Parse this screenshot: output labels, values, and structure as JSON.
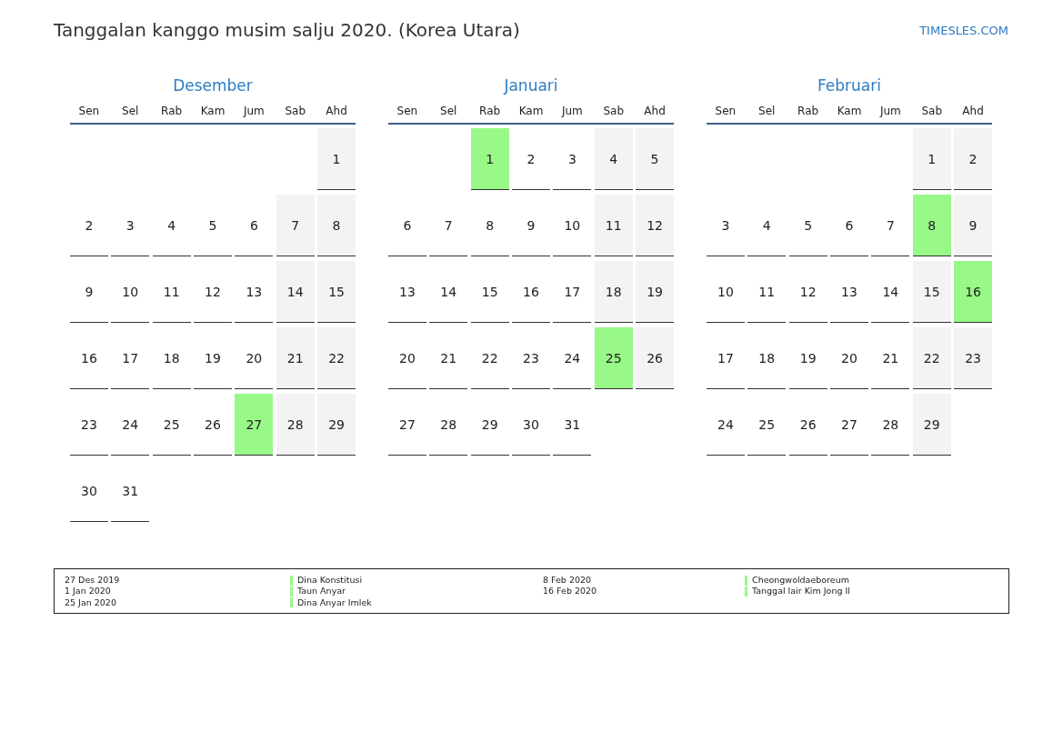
{
  "title": "Tanggalan kanggo musim salju 2020. (Korea Utara)",
  "site": "TIMESLES.COM",
  "months": [
    {
      "name": "Desember",
      "weekdays": [
        "Sen",
        "Sel",
        "Rab",
        "Kam",
        "Jum",
        "Sab",
        "Ahd"
      ],
      "weeks": [
        [
          {
            "kind": "blank"
          },
          {
            "kind": "blank"
          },
          {
            "kind": "blank"
          },
          {
            "kind": "blank"
          },
          {
            "kind": "blank"
          },
          {
            "kind": "blank"
          },
          {
            "kind": "date",
            "day": "1",
            "weekend": true,
            "holiday": false
          }
        ],
        [
          {
            "kind": "date",
            "day": "2",
            "weekend": false,
            "holiday": false
          },
          {
            "kind": "date",
            "day": "3",
            "weekend": false,
            "holiday": false
          },
          {
            "kind": "date",
            "day": "4",
            "weekend": false,
            "holiday": false
          },
          {
            "kind": "date",
            "day": "5",
            "weekend": false,
            "holiday": false
          },
          {
            "kind": "date",
            "day": "6",
            "weekend": false,
            "holiday": false
          },
          {
            "kind": "date",
            "day": "7",
            "weekend": true,
            "holiday": false
          },
          {
            "kind": "date",
            "day": "8",
            "weekend": true,
            "holiday": false
          }
        ],
        [
          {
            "kind": "date",
            "day": "9",
            "weekend": false,
            "holiday": false
          },
          {
            "kind": "date",
            "day": "10",
            "weekend": false,
            "holiday": false
          },
          {
            "kind": "date",
            "day": "11",
            "weekend": false,
            "holiday": false
          },
          {
            "kind": "date",
            "day": "12",
            "weekend": false,
            "holiday": false
          },
          {
            "kind": "date",
            "day": "13",
            "weekend": false,
            "holiday": false
          },
          {
            "kind": "date",
            "day": "14",
            "weekend": true,
            "holiday": false
          },
          {
            "kind": "date",
            "day": "15",
            "weekend": true,
            "holiday": false
          }
        ],
        [
          {
            "kind": "date",
            "day": "16",
            "weekend": false,
            "holiday": false
          },
          {
            "kind": "date",
            "day": "17",
            "weekend": false,
            "holiday": false
          },
          {
            "kind": "date",
            "day": "18",
            "weekend": false,
            "holiday": false
          },
          {
            "kind": "date",
            "day": "19",
            "weekend": false,
            "holiday": false
          },
          {
            "kind": "date",
            "day": "20",
            "weekend": false,
            "holiday": false
          },
          {
            "kind": "date",
            "day": "21",
            "weekend": true,
            "holiday": false
          },
          {
            "kind": "date",
            "day": "22",
            "weekend": true,
            "holiday": false
          }
        ],
        [
          {
            "kind": "date",
            "day": "23",
            "weekend": false,
            "holiday": false
          },
          {
            "kind": "date",
            "day": "24",
            "weekend": false,
            "holiday": false
          },
          {
            "kind": "date",
            "day": "25",
            "weekend": false,
            "holiday": false
          },
          {
            "kind": "date",
            "day": "26",
            "weekend": false,
            "holiday": false
          },
          {
            "kind": "date",
            "day": "27",
            "weekend": false,
            "holiday": true
          },
          {
            "kind": "date",
            "day": "28",
            "weekend": true,
            "holiday": false
          },
          {
            "kind": "date",
            "day": "29",
            "weekend": true,
            "holiday": false
          }
        ],
        [
          {
            "kind": "date",
            "day": "30",
            "weekend": false,
            "holiday": false
          },
          {
            "kind": "date",
            "day": "31",
            "weekend": false,
            "holiday": false
          }
        ]
      ]
    },
    {
      "name": "Januari",
      "weekdays": [
        "Sen",
        "Sel",
        "Rab",
        "Kam",
        "Jum",
        "Sab",
        "Ahd"
      ],
      "weeks": [
        [
          {
            "kind": "blank"
          },
          {
            "kind": "blank"
          },
          {
            "kind": "date",
            "day": "1",
            "weekend": false,
            "holiday": true
          },
          {
            "kind": "date",
            "day": "2",
            "weekend": false,
            "holiday": false
          },
          {
            "kind": "date",
            "day": "3",
            "weekend": false,
            "holiday": false
          },
          {
            "kind": "date",
            "day": "4",
            "weekend": true,
            "holiday": false
          },
          {
            "kind": "date",
            "day": "5",
            "weekend": true,
            "holiday": false
          }
        ],
        [
          {
            "kind": "date",
            "day": "6",
            "weekend": false,
            "holiday": false
          },
          {
            "kind": "date",
            "day": "7",
            "weekend": false,
            "holiday": false
          },
          {
            "kind": "date",
            "day": "8",
            "weekend": false,
            "holiday": false
          },
          {
            "kind": "date",
            "day": "9",
            "weekend": false,
            "holiday": false
          },
          {
            "kind": "date",
            "day": "10",
            "weekend": false,
            "holiday": false
          },
          {
            "kind": "date",
            "day": "11",
            "weekend": true,
            "holiday": false
          },
          {
            "kind": "date",
            "day": "12",
            "weekend": true,
            "holiday": false
          }
        ],
        [
          {
            "kind": "date",
            "day": "13",
            "weekend": false,
            "holiday": false
          },
          {
            "kind": "date",
            "day": "14",
            "weekend": false,
            "holiday": false
          },
          {
            "kind": "date",
            "day": "15",
            "weekend": false,
            "holiday": false
          },
          {
            "kind": "date",
            "day": "16",
            "weekend": false,
            "holiday": false
          },
          {
            "kind": "date",
            "day": "17",
            "weekend": false,
            "holiday": false
          },
          {
            "kind": "date",
            "day": "18",
            "weekend": true,
            "holiday": false
          },
          {
            "kind": "date",
            "day": "19",
            "weekend": true,
            "holiday": false
          }
        ],
        [
          {
            "kind": "date",
            "day": "20",
            "weekend": false,
            "holiday": false
          },
          {
            "kind": "date",
            "day": "21",
            "weekend": false,
            "holiday": false
          },
          {
            "kind": "date",
            "day": "22",
            "weekend": false,
            "holiday": false
          },
          {
            "kind": "date",
            "day": "23",
            "weekend": false,
            "holiday": false
          },
          {
            "kind": "date",
            "day": "24",
            "weekend": false,
            "holiday": false
          },
          {
            "kind": "date",
            "day": "25",
            "weekend": true,
            "holiday": true
          },
          {
            "kind": "date",
            "day": "26",
            "weekend": true,
            "holiday": false
          }
        ],
        [
          {
            "kind": "date",
            "day": "27",
            "weekend": false,
            "holiday": false
          },
          {
            "kind": "date",
            "day": "28",
            "weekend": false,
            "holiday": false
          },
          {
            "kind": "date",
            "day": "29",
            "weekend": false,
            "holiday": false
          },
          {
            "kind": "date",
            "day": "30",
            "weekend": false,
            "holiday": false
          },
          {
            "kind": "date",
            "day": "31",
            "weekend": false,
            "holiday": false
          }
        ]
      ]
    },
    {
      "name": "Februari",
      "weekdays": [
        "Sen",
        "Sel",
        "Rab",
        "Kam",
        "Jum",
        "Sab",
        "Ahd"
      ],
      "weeks": [
        [
          {
            "kind": "blank"
          },
          {
            "kind": "blank"
          },
          {
            "kind": "blank"
          },
          {
            "kind": "blank"
          },
          {
            "kind": "blank"
          },
          {
            "kind": "date",
            "day": "1",
            "weekend": true,
            "holiday": false
          },
          {
            "kind": "date",
            "day": "2",
            "weekend": true,
            "holiday": false
          }
        ],
        [
          {
            "kind": "date",
            "day": "3",
            "weekend": false,
            "holiday": false
          },
          {
            "kind": "date",
            "day": "4",
            "weekend": false,
            "holiday": false
          },
          {
            "kind": "date",
            "day": "5",
            "weekend": false,
            "holiday": false
          },
          {
            "kind": "date",
            "day": "6",
            "weekend": false,
            "holiday": false
          },
          {
            "kind": "date",
            "day": "7",
            "weekend": false,
            "holiday": false
          },
          {
            "kind": "date",
            "day": "8",
            "weekend": true,
            "holiday": true
          },
          {
            "kind": "date",
            "day": "9",
            "weekend": true,
            "holiday": false
          }
        ],
        [
          {
            "kind": "date",
            "day": "10",
            "weekend": false,
            "holiday": false
          },
          {
            "kind": "date",
            "day": "11",
            "weekend": false,
            "holiday": false
          },
          {
            "kind": "date",
            "day": "12",
            "weekend": false,
            "holiday": false
          },
          {
            "kind": "date",
            "day": "13",
            "weekend": false,
            "holiday": false
          },
          {
            "kind": "date",
            "day": "14",
            "weekend": false,
            "holiday": false
          },
          {
            "kind": "date",
            "day": "15",
            "weekend": true,
            "holiday": false
          },
          {
            "kind": "date",
            "day": "16",
            "weekend": true,
            "holiday": true
          }
        ],
        [
          {
            "kind": "date",
            "day": "17",
            "weekend": false,
            "holiday": false
          },
          {
            "kind": "date",
            "day": "18",
            "weekend": false,
            "holiday": false
          },
          {
            "kind": "date",
            "day": "19",
            "weekend": false,
            "holiday": false
          },
          {
            "kind": "date",
            "day": "20",
            "weekend": false,
            "holiday": false
          },
          {
            "kind": "date",
            "day": "21",
            "weekend": false,
            "holiday": false
          },
          {
            "kind": "date",
            "day": "22",
            "weekend": true,
            "holiday": false
          },
          {
            "kind": "date",
            "day": "23",
            "weekend": true,
            "holiday": false
          }
        ],
        [
          {
            "kind": "date",
            "day": "24",
            "weekend": false,
            "holiday": false
          },
          {
            "kind": "date",
            "day": "25",
            "weekend": false,
            "holiday": false
          },
          {
            "kind": "date",
            "day": "26",
            "weekend": false,
            "holiday": false
          },
          {
            "kind": "date",
            "day": "27",
            "weekend": false,
            "holiday": false
          },
          {
            "kind": "date",
            "day": "28",
            "weekend": false,
            "holiday": false
          },
          {
            "kind": "date",
            "day": "29",
            "weekend": true,
            "holiday": false
          }
        ]
      ]
    }
  ],
  "legend": [
    [
      {
        "date": "27 Des 2019",
        "name": "Dina Konstitusi"
      },
      {
        "date": "1 Jan 2020",
        "name": "Taun Anyar"
      },
      {
        "date": "25 Jan 2020",
        "name": "Dina Anyar Imlek"
      }
    ],
    [
      {
        "date": "8 Feb 2020",
        "name": "Cheongwoldaeboreum"
      },
      {
        "date": "16 Feb 2020",
        "name": "Tanggal lair Kim Jong Il"
      }
    ]
  ]
}
